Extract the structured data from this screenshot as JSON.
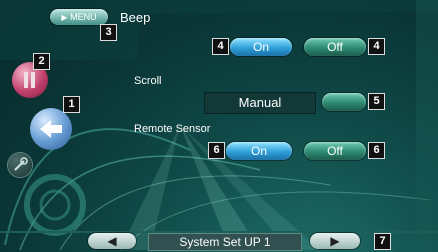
{
  "menu_button": {
    "label": "MENU",
    "icon": "play-triangle-icon"
  },
  "sections": {
    "beep": {
      "title": "Beep",
      "on_label": "On",
      "off_label": "Off"
    },
    "scroll": {
      "title": "Scroll",
      "value": "Manual"
    },
    "remote_sensor": {
      "title": "Remote Sensor",
      "on_label": "On",
      "off_label": "Off"
    }
  },
  "footer": {
    "title": "System Set UP 1",
    "prev_icon": "left-triangle-icon",
    "next_icon": "right-triangle-icon"
  },
  "callouts": {
    "c1": "1",
    "c2": "2",
    "c3": "3",
    "c4a": "4",
    "c4b": "4",
    "c5": "5",
    "c6a": "6",
    "c6b": "6",
    "c7": "7"
  },
  "colors": {
    "on_button": "#2f9fd8",
    "off_button": "#2e8a72",
    "value_box": "#123838",
    "background": "#0f4a48"
  }
}
